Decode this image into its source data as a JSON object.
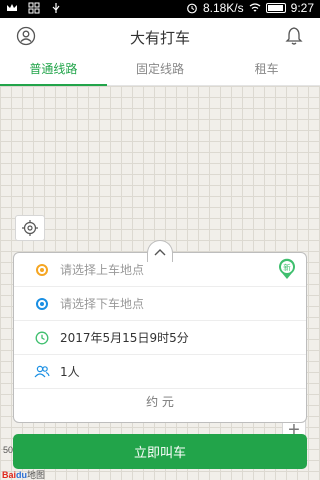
{
  "statusbar": {
    "speed": "8.18K/s",
    "time": "9:27"
  },
  "header": {
    "title": "大有打车",
    "profile_icon": "user-icon",
    "notify_icon": "bell-icon"
  },
  "tabs": [
    {
      "label": "普通线路",
      "active": true
    },
    {
      "label": "固定线路",
      "active": false
    },
    {
      "label": "租车",
      "active": false
    }
  ],
  "booking": {
    "pickup_placeholder": "请选择上车地点",
    "dropoff_placeholder": "请选择下车地点",
    "time": "2017年5月15日9时5分",
    "passengers": "1人",
    "price": "约 元",
    "pin_label": "新"
  },
  "call_button": "立即叫车",
  "map": {
    "scale": "50",
    "logo_red": "Bai",
    "logo_blue": "du",
    "logo_suffix": "地图"
  },
  "colors": {
    "accent": "#22a44a",
    "pickup": "#f5a623",
    "dropoff": "#1a8fe3"
  }
}
